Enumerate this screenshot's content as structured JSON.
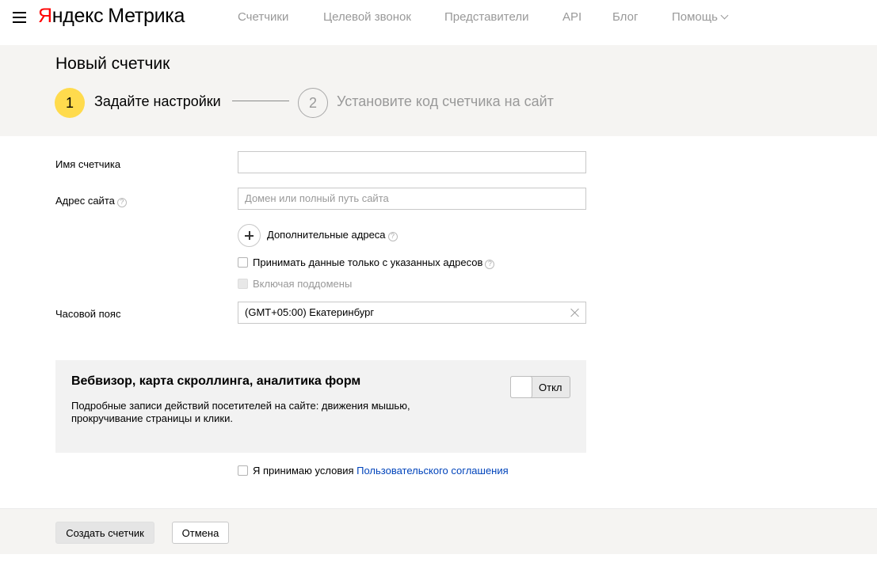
{
  "header": {
    "logo_first_letter": "Я",
    "logo_first_rest": "ндекс",
    "logo_second": "Метрика",
    "nav": [
      {
        "label": "Счетчики"
      },
      {
        "label": "Целевой звонок"
      },
      {
        "label": "Представители"
      },
      {
        "label": "API"
      },
      {
        "label": "Блог"
      },
      {
        "label": "Помощь"
      }
    ]
  },
  "page": {
    "title": "Новый счетчик",
    "steps": [
      {
        "number": "1",
        "label": "Задайте настройки",
        "active": true
      },
      {
        "number": "2",
        "label": "Установите код счетчика на сайт",
        "active": false
      }
    ]
  },
  "form": {
    "counter_name": {
      "label": "Имя счетчика",
      "value": ""
    },
    "site_address": {
      "label": "Адрес сайта",
      "placeholder": "Домен или полный путь сайта",
      "value": ""
    },
    "additional_addresses_label": "Дополнительные адреса",
    "only_listed_addresses": {
      "label": "Принимать данные только с указанных адресов",
      "checked": false
    },
    "include_subdomains": {
      "label": "Включая поддомены",
      "checked": false,
      "disabled": true
    },
    "timezone": {
      "label": "Часовой пояс",
      "value": "(GMT+05:00) Екатеринбург"
    },
    "help_glyph": "?"
  },
  "webvisor": {
    "title": "Вебвизор, карта скроллинга, аналитика форм",
    "description": "Подробные записи действий посетителей на сайте: движения мышью, прокручивание страницы и клики.",
    "toggle_label": "Откл",
    "enabled": false
  },
  "agreement": {
    "text": "Я принимаю условия ",
    "link_text": "Пользовательского соглашения",
    "checked": false
  },
  "footer": {
    "create_label": "Создать счетчик",
    "cancel_label": "Отмена"
  },
  "colors": {
    "accent_yellow": "#ffdb4d",
    "logo_red": "#ff0000",
    "link_blue": "#0044bb",
    "band_bg": "#f5f4f2"
  }
}
